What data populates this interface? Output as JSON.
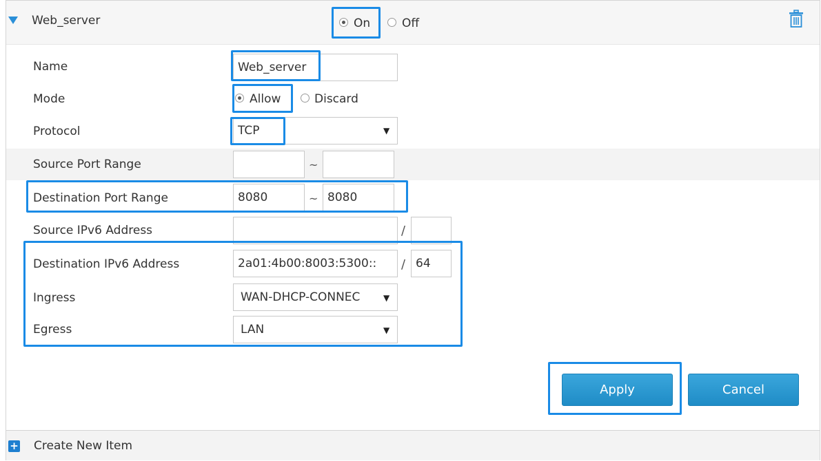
{
  "header": {
    "title": "Web_server",
    "on_label": "On",
    "off_label": "Off"
  },
  "form": {
    "name_label": "Name",
    "name_value": "Web_server",
    "mode_label": "Mode",
    "mode_allow": "Allow",
    "mode_discard": "Discard",
    "protocol_label": "Protocol",
    "protocol_value": "TCP",
    "src_port_label": "Source Port Range",
    "src_port_from": "",
    "src_port_to": "",
    "dst_port_label": "Destination Port Range",
    "dst_port_from": "8080",
    "dst_port_to": "8080",
    "src_ipv6_label": "Source IPv6 Address",
    "src_ipv6_value": "",
    "src_ipv6_prefix": "",
    "dst_ipv6_label": "Destination IPv6 Address",
    "dst_ipv6_value": "2a01:4b00:8003:5300::",
    "dst_ipv6_prefix": "64",
    "ingress_label": "Ingress",
    "ingress_value": "WAN-DHCP-CONNEC",
    "egress_label": "Egress",
    "egress_value": "LAN",
    "separator_tilde": "~",
    "separator_slash": "/"
  },
  "buttons": {
    "apply": "Apply",
    "cancel": "Cancel"
  },
  "footer": {
    "create_label": "Create New Item"
  },
  "colors": {
    "accent": "#1a8be6",
    "button": "#2b9ad4",
    "triangle": "#2a8fd8"
  }
}
